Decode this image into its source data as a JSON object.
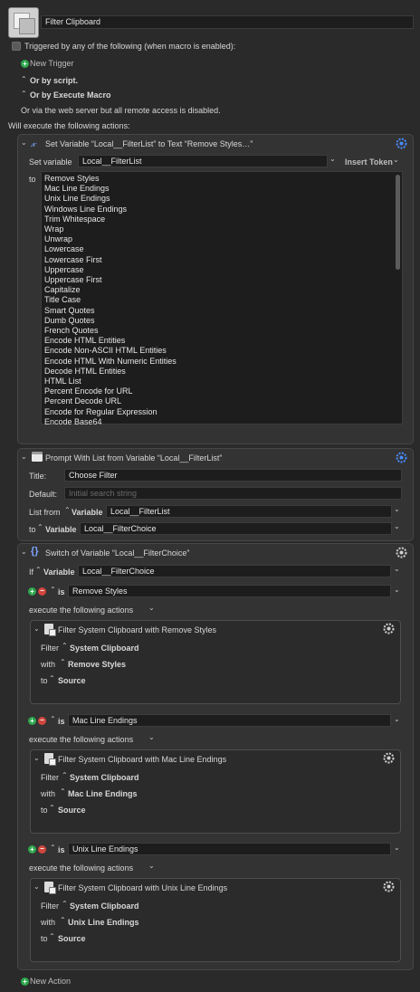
{
  "macro": {
    "name": "Filter Clipboard",
    "triggered_label": "Triggered by any of the following (when macro is enabled):",
    "new_trigger": "New Trigger",
    "or_by_script": "Or by script.",
    "or_by_execute": "Or by Execute Macro",
    "web_server_note": "Or via the web server but all remote access is disabled.",
    "will_execute": "Will execute the following actions:",
    "new_action": "New Action"
  },
  "action1": {
    "title": "Set Variable “Local__FilterList” to Text “Remove Styles…”",
    "set_variable_label": "Set variable",
    "variable_name": "Local__FilterList",
    "insert_token": "Insert Token",
    "to_label": "to",
    "text_lines": [
      "Remove Styles",
      "Mac Line Endings",
      "Unix Line Endings",
      "Windows Line Endings",
      "Trim Whitespace",
      "Wrap",
      "Unwrap",
      "Lowercase",
      "Lowercase First",
      "Uppercase",
      "Uppercase First",
      "Capitalize",
      "Title Case",
      "Smart Quotes",
      "Dumb Quotes",
      "French Quotes",
      "Encode HTML Entities",
      "Encode Non-ASCII HTML Entities",
      "Encode HTML With Numeric Entities",
      "Decode HTML Entities",
      "HTML List",
      "Percent Encode for URL",
      "Percent Decode URL",
      "Encode for Regular Expression",
      "Encode Base64"
    ]
  },
  "action2": {
    "title": "Prompt With List from Variable “Local__FilterList”",
    "title_label": "Title:",
    "title_value": "Choose Filter",
    "default_label": "Default:",
    "default_placeholder": "Initial search string",
    "list_from_label": "List from",
    "variable_word": "Variable",
    "list_from_value": "Local__FilterList",
    "to_label": "to",
    "to_value": "Local__FilterChoice"
  },
  "action3": {
    "title": "Switch of Variable “Local__FilterChoice”",
    "if_label": "If",
    "variable_word": "Variable",
    "variable_value": "Local__FilterChoice",
    "is_label": "is",
    "execute_label": "execute the following actions",
    "filter_label": "Filter",
    "with_label": "with",
    "to_label": "to",
    "system_clipboard": "System Clipboard",
    "source": "Source",
    "cases": [
      {
        "value": "Remove Styles",
        "action_title": "Filter System Clipboard with Remove Styles",
        "filter": "Remove Styles"
      },
      {
        "value": "Mac Line Endings",
        "action_title": "Filter System Clipboard with Mac Line Endings",
        "filter": "Mac Line Endings"
      },
      {
        "value": "Unix Line Endings",
        "action_title": "Filter System Clipboard with Unix Line Endings",
        "filter": "Unix Line Endings"
      }
    ]
  },
  "icons": {
    "gear": "gear-icon",
    "variable": "x-variable-icon",
    "prompt": "window-icon",
    "switch": "braces-icon",
    "filter": "document-filter-icon"
  }
}
